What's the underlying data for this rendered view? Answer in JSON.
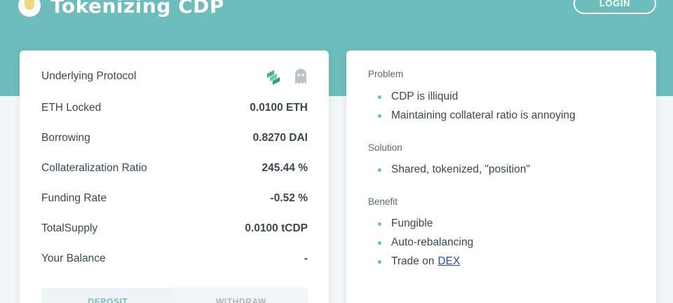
{
  "header": {
    "title": "Tokenizing CDP",
    "login_label": "LOGIN",
    "accent": "#6cbdbc"
  },
  "position_card": {
    "rows": [
      {
        "label": "Underlying Protocol",
        "value": ""
      },
      {
        "label": "ETH Locked",
        "value": "0.0100 ETH"
      },
      {
        "label": "Borrowing",
        "value": "0.8270 DAI"
      },
      {
        "label": "Collateralization Ratio",
        "value": "245.44 %"
      },
      {
        "label": "Funding Rate",
        "value": "-0.52 %"
      },
      {
        "label": "TotalSupply",
        "value": "0.0100 tCDP"
      },
      {
        "label": "Your Balance",
        "value": "-"
      }
    ],
    "protocol_icons": [
      "compound-icon",
      "ghost-icon"
    ],
    "tabs": [
      {
        "label": "DEPOSIT",
        "active": true
      },
      {
        "label": "WITHDRAW",
        "active": false
      }
    ]
  },
  "info_card": {
    "sections": [
      {
        "title": "Problem",
        "items": [
          "CDP is illiquid",
          "Maintaining collateral ratio is annoying"
        ]
      },
      {
        "title": "Solution",
        "items": [
          "Shared, tokenized, \"position\""
        ]
      },
      {
        "title": "Benefit",
        "items": [
          "Fungible",
          "Auto-rebalancing",
          "Trade on"
        ],
        "link_text": "DEX"
      }
    ]
  }
}
